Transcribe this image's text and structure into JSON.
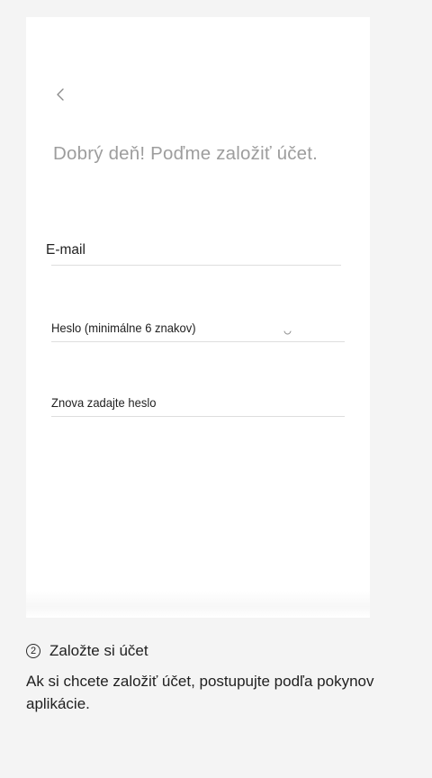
{
  "app": {
    "back_icon": "chevron-left-icon",
    "greeting": "Dobrý deň! Poďme založiť účet."
  },
  "form": {
    "email_label": "E-mail",
    "password_label": "Heslo (minimálne 6 znakov)",
    "confirm_password_label": "Znova zadajte heslo",
    "password_visibility_icon": "eye-icon"
  },
  "instructions": {
    "step_number": "2",
    "step_title": "Založte si účet",
    "body": "Ak si chcete založiť účet, postupujte podľa pokynov aplikácie."
  },
  "colors": {
    "page_background": "#f4f4f4",
    "panel_background": "#ffffff",
    "greeting_text": "#9d9d9d",
    "field_text": "#222222",
    "divider": "#dedede",
    "caption_text": "#1f1f1f"
  }
}
